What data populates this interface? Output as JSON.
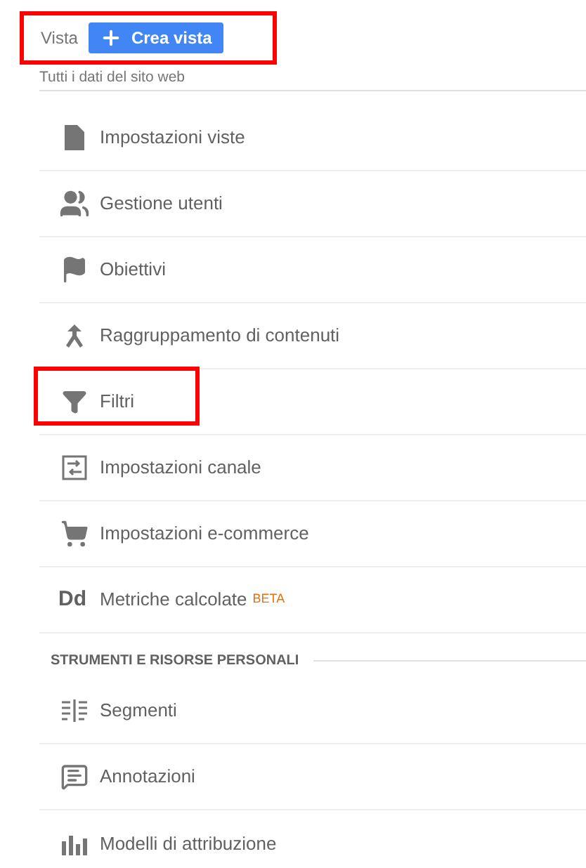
{
  "header": {
    "label": "Vista",
    "button": "Crea vista",
    "highlighted": true,
    "subtitle": "Tutti i dati del sito web"
  },
  "sections": [
    {
      "items": [
        {
          "label": "Impostazioni viste",
          "highlighted": false
        },
        {
          "label": "Gestione utenti",
          "highlighted": false
        },
        {
          "label": "Obiettivi",
          "highlighted": false
        },
        {
          "label": "Raggruppamento di contenuti",
          "highlighted": false
        },
        {
          "label": "Filtri",
          "highlighted": true
        },
        {
          "label": "Impostazioni canale",
          "highlighted": false
        },
        {
          "label": "Impostazioni e-commerce",
          "highlighted": false
        },
        {
          "label": "Metriche calcolate",
          "glyph": "Dd",
          "badge": "BETA",
          "highlighted": false
        }
      ]
    },
    {
      "heading": "STRUMENTI E RISORSE PERSONALI",
      "items": [
        {
          "label": "Segmenti",
          "highlighted": false
        },
        {
          "label": "Annotazioni",
          "highlighted": false
        },
        {
          "label": "Modelli di attribuzione",
          "highlighted": false
        }
      ]
    }
  ]
}
